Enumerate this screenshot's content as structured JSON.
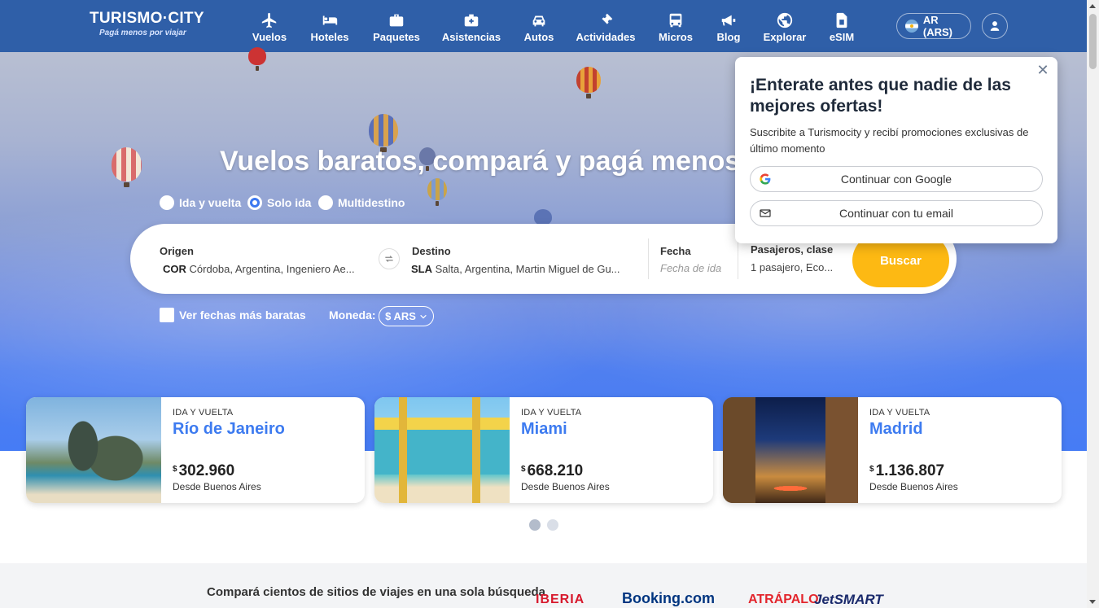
{
  "header": {
    "logo_title": "TURISMO·CITY",
    "logo_tagline": "Pagá menos por viajar",
    "nav": [
      {
        "label": "Vuelos",
        "icon": "plane-icon"
      },
      {
        "label": "Hoteles",
        "icon": "bed-icon"
      },
      {
        "label": "Paquetes",
        "icon": "suitcase-icon"
      },
      {
        "label": "Asistencias",
        "icon": "medkit-icon"
      },
      {
        "label": "Autos",
        "icon": "car-icon"
      },
      {
        "label": "Actividades",
        "icon": "ticket-icon"
      },
      {
        "label": "Micros",
        "icon": "bus-icon"
      },
      {
        "label": "Blog",
        "icon": "megaphone-icon"
      },
      {
        "label": "Explorar",
        "icon": "globe-icon"
      },
      {
        "label": "eSIM",
        "icon": "sim-icon"
      }
    ],
    "region": "AR (ARS)"
  },
  "hero": {
    "title": "Vuelos baratos, compará y pagá menos",
    "trip_types": [
      "Ida y vuelta",
      "Solo ida",
      "Multidestino"
    ],
    "selected_trip_type": "Solo ida"
  },
  "search": {
    "origin_label": "Origen",
    "origin_code": "COR",
    "origin_value": "Córdoba, Argentina, Ingeniero Ae...",
    "destination_label": "Destino",
    "destination_code": "SLA",
    "destination_value": "Salta, Argentina, Martin Miguel de Gu...",
    "date_label": "Fecha",
    "date_placeholder": "Fecha de ida",
    "passengers_label": "Pasajeros, clase",
    "passengers_value": "1 pasajero, Eco...",
    "search_button": "Buscar",
    "cheap_dates_label": "Ver fechas más baratas",
    "currency_label": "Moneda:",
    "currency_value": "$ ARS"
  },
  "deals": [
    {
      "tag": "IDA Y VUELTA",
      "city": "Río de Janeiro",
      "currency": "$",
      "price": "302.960",
      "from": "Desde Buenos Aires"
    },
    {
      "tag": "IDA Y VUELTA",
      "city": "Miami",
      "currency": "$",
      "price": "668.210",
      "from": "Desde Buenos Aires"
    },
    {
      "tag": "IDA Y VUELTA",
      "city": "Madrid",
      "currency": "$",
      "price": "1.136.807",
      "from": "Desde Buenos Aires"
    }
  ],
  "carousel": {
    "pages": 2,
    "active": 1
  },
  "bottom": {
    "compare_text": "Compará cientos de sitios de viajes en una sola búsqueda",
    "brands": [
      "IBERIA",
      "Booking.com",
      "ATRÁPALO",
      "JetSMART"
    ]
  },
  "popup": {
    "title": "¡Enterate antes que nadie de las mejores ofertas!",
    "text": "Suscribite a Turismocity y recibí promociones exclusivas de último momento",
    "google_button": "Continuar con Google",
    "email_button": "Continuar con tu email",
    "close": "✕"
  },
  "colors": {
    "header_bg": "#2f5fa8",
    "accent_blue": "#3d7bf0",
    "search_button": "#fdb913"
  }
}
